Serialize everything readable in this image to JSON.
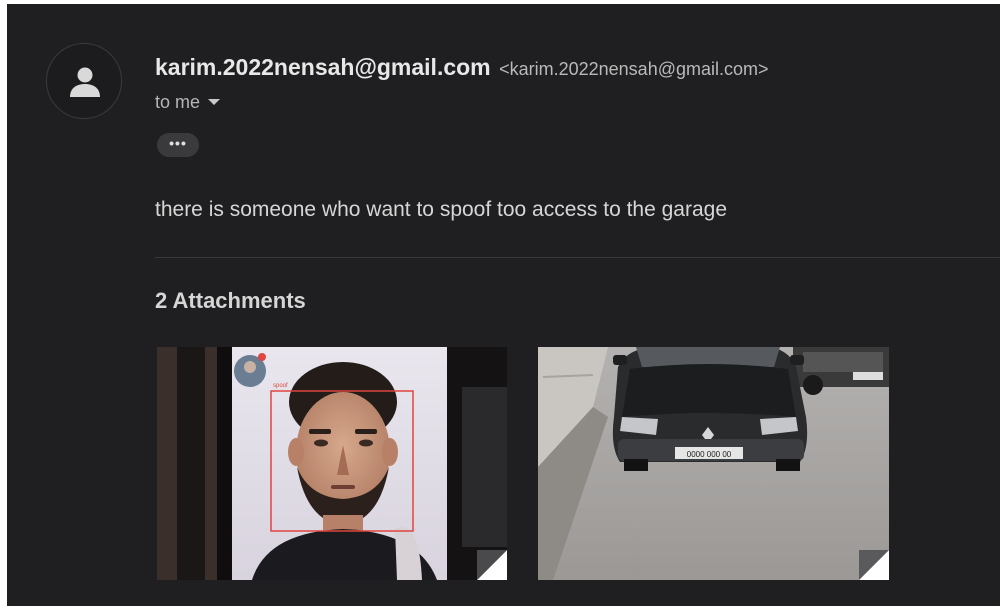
{
  "message": {
    "sender_name": "karim.2022nensah@gmail.com",
    "sender_email": "<karim.2022nensah@gmail.com>",
    "recipient_label": "to me",
    "more_label": "•••",
    "body": "there is someone who want to spoof too access to the garage"
  },
  "attachments": {
    "title": "2 Attachments",
    "items": [
      {
        "icon": "face-photo-thumbnail",
        "overlay_label": "spoof"
      },
      {
        "icon": "car-photo-thumbnail",
        "plate_text": "0000 000 00"
      }
    ]
  },
  "colors": {
    "background": "#1f1f21",
    "detection_box": "#e0453f"
  }
}
